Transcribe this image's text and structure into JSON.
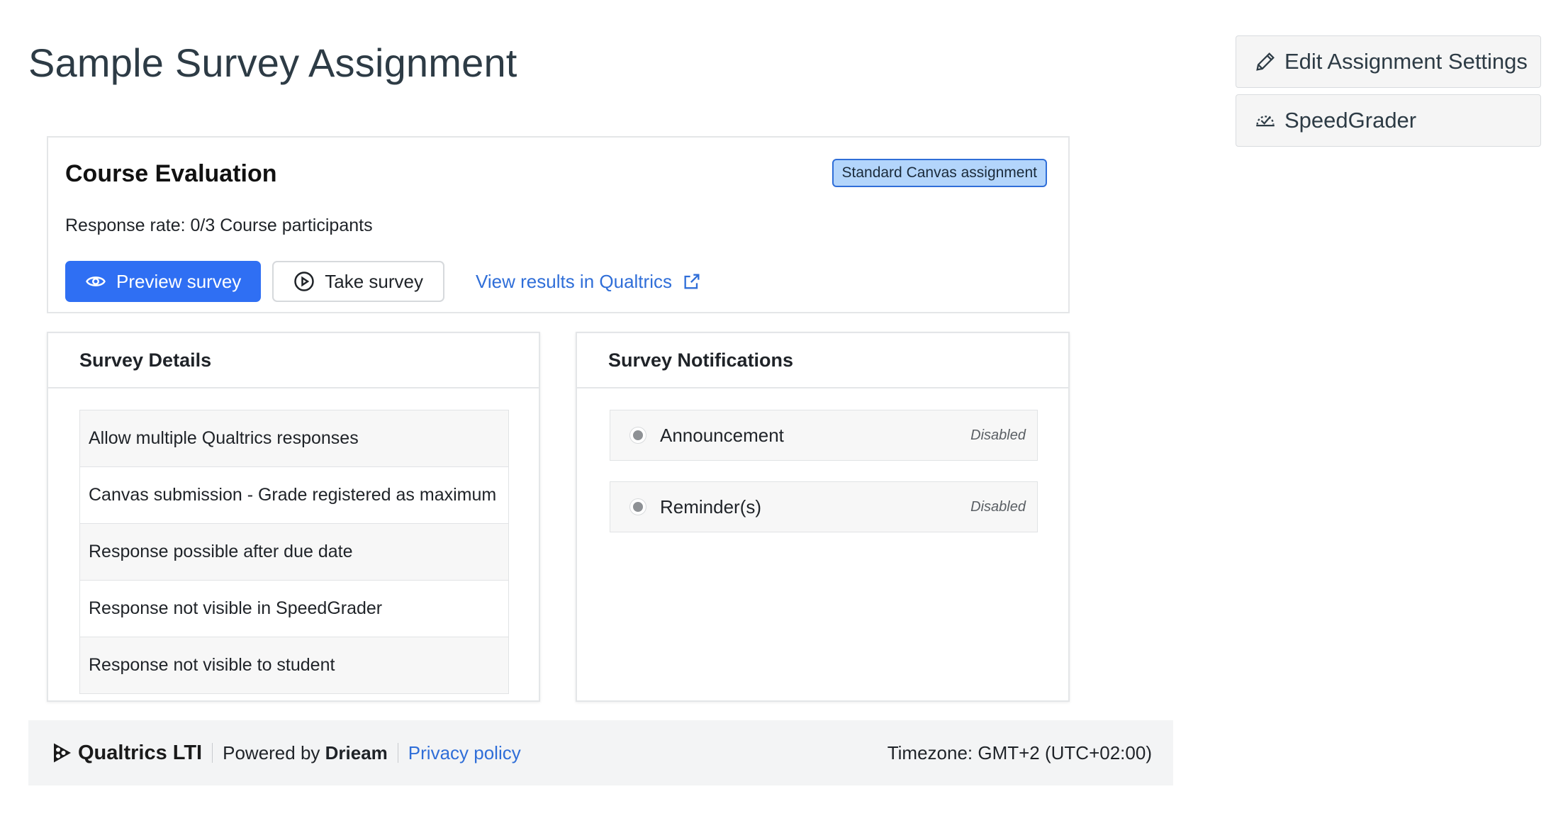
{
  "page": {
    "title": "Sample Survey Assignment"
  },
  "sidebar": {
    "edit_label": "Edit Assignment Settings",
    "speedgrader_label": "SpeedGrader"
  },
  "evaluation": {
    "title": "Course Evaluation",
    "badge": "Standard Canvas assignment",
    "response_rate": "Response rate: 0/3 Course participants",
    "preview_label": "Preview survey",
    "take_label": "Take survey",
    "results_label": "View results in Qualtrics"
  },
  "details": {
    "title": "Survey Details",
    "items": [
      "Allow multiple Qualtrics responses",
      "Canvas submission - Grade registered as maximum",
      "Response possible after due date",
      "Response not visible in SpeedGrader",
      "Response not visible to student"
    ]
  },
  "notifications": {
    "title": "Survey Notifications",
    "items": [
      {
        "label": "Announcement",
        "status": "Disabled"
      },
      {
        "label": "Reminder(s)",
        "status": "Disabled"
      }
    ]
  },
  "footer": {
    "brand": "Qualtrics LTI",
    "powered_prefix": "Powered by",
    "powered_name": "Drieam",
    "privacy": "Privacy policy",
    "timezone": "Timezone: GMT+2 (UTC+02:00)"
  },
  "colors": {
    "primary": "#2f6ff3",
    "link": "#2f6ed8",
    "badge_bg": "#b3d5fb"
  }
}
